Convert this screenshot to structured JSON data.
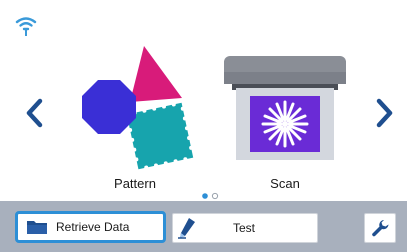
{
  "header": {
    "wifi_icon": "wifi-icon"
  },
  "navigation": {
    "prev_icon": "chevron-left-icon",
    "next_icon": "chevron-right-icon"
  },
  "tiles": [
    {
      "label": "Pattern",
      "icon": "pattern-shapes-icon"
    },
    {
      "label": "Scan",
      "icon": "scan-icon"
    }
  ],
  "pagination": {
    "total": 2,
    "current": 1
  },
  "toolbar": {
    "retrieve_label": "Retrieve Data",
    "retrieve_icon": "folder-icon",
    "test_label": "Test",
    "test_icon": "pen-blade-icon",
    "settings_icon": "wrench-icon"
  },
  "colors": {
    "accent": "#2d8fd6",
    "bar": "#a8b0bd",
    "arrow": "#1f4f8f"
  }
}
